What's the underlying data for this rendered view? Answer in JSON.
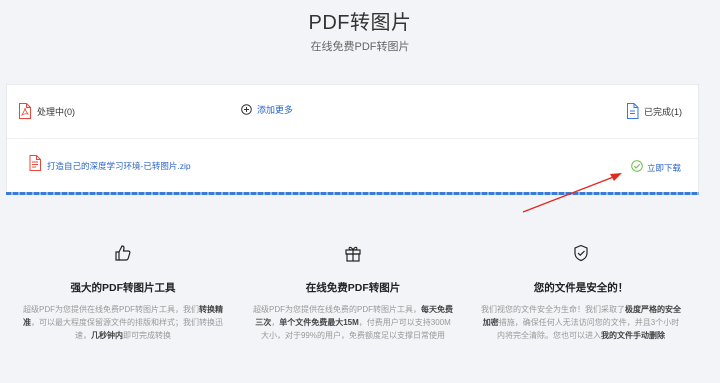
{
  "header": {
    "title": "PDF转图片",
    "subtitle": "在线免费PDF转图片"
  },
  "toolbar": {
    "processing_label": "处理中(0)",
    "add_more_label": "添加更多",
    "completed_label": "已完成(1)"
  },
  "file": {
    "name": "打造自己的深度学习环境-已转图片.zip",
    "download_label": "立即下载"
  },
  "features": [
    {
      "title": "强大的PDF转图片工具",
      "desc_parts": [
        {
          "t": "超级PDF为您提供在线免费PDF转图片工具，我们",
          "b": false
        },
        {
          "t": "转换精准",
          "b": true
        },
        {
          "t": "，可以最大程度保留源文件的排版和样式；我们转换迅速，",
          "b": false
        },
        {
          "t": "几秒钟内",
          "b": true
        },
        {
          "t": "即可完成转换",
          "b": false
        }
      ]
    },
    {
      "title": "在线免费PDF转图片",
      "desc_parts": [
        {
          "t": "超级PDF为您提供在线免费的PDF转图片工具，",
          "b": false
        },
        {
          "t": "每天免费三次",
          "b": true
        },
        {
          "t": "，",
          "b": false
        },
        {
          "t": "单个文件免费最大15M",
          "b": true
        },
        {
          "t": "，付费用户可以支持300M大小，对于99%的用户，免费额度足以支撑日常使用",
          "b": false
        }
      ]
    },
    {
      "title": "您的文件是安全的！",
      "desc_parts": [
        {
          "t": "我们视您的文件安全为生命！我们采取了",
          "b": false
        },
        {
          "t": "极度严格的安全加密",
          "b": true
        },
        {
          "t": "措施，确保任何人无法访问您的文件，并且3个小时内将完全清除。您也可以进入",
          "b": false
        },
        {
          "t": "我的文件手动删除",
          "b": true
        }
      ]
    }
  ],
  "colors": {
    "accent": "#2a64c8",
    "pdf_red": "#e8473b",
    "done_green": "#6cc04a",
    "arrow_red": "#e02a20"
  },
  "icons": {
    "processing": "pdf-file-icon",
    "add_more": "plus-circle-icon",
    "completed": "document-icon",
    "file": "pdf-file-icon",
    "download": "check-circle-icon",
    "feature_1": "thumbs-up-icon",
    "feature_2": "gift-icon",
    "feature_3": "shield-check-icon"
  }
}
